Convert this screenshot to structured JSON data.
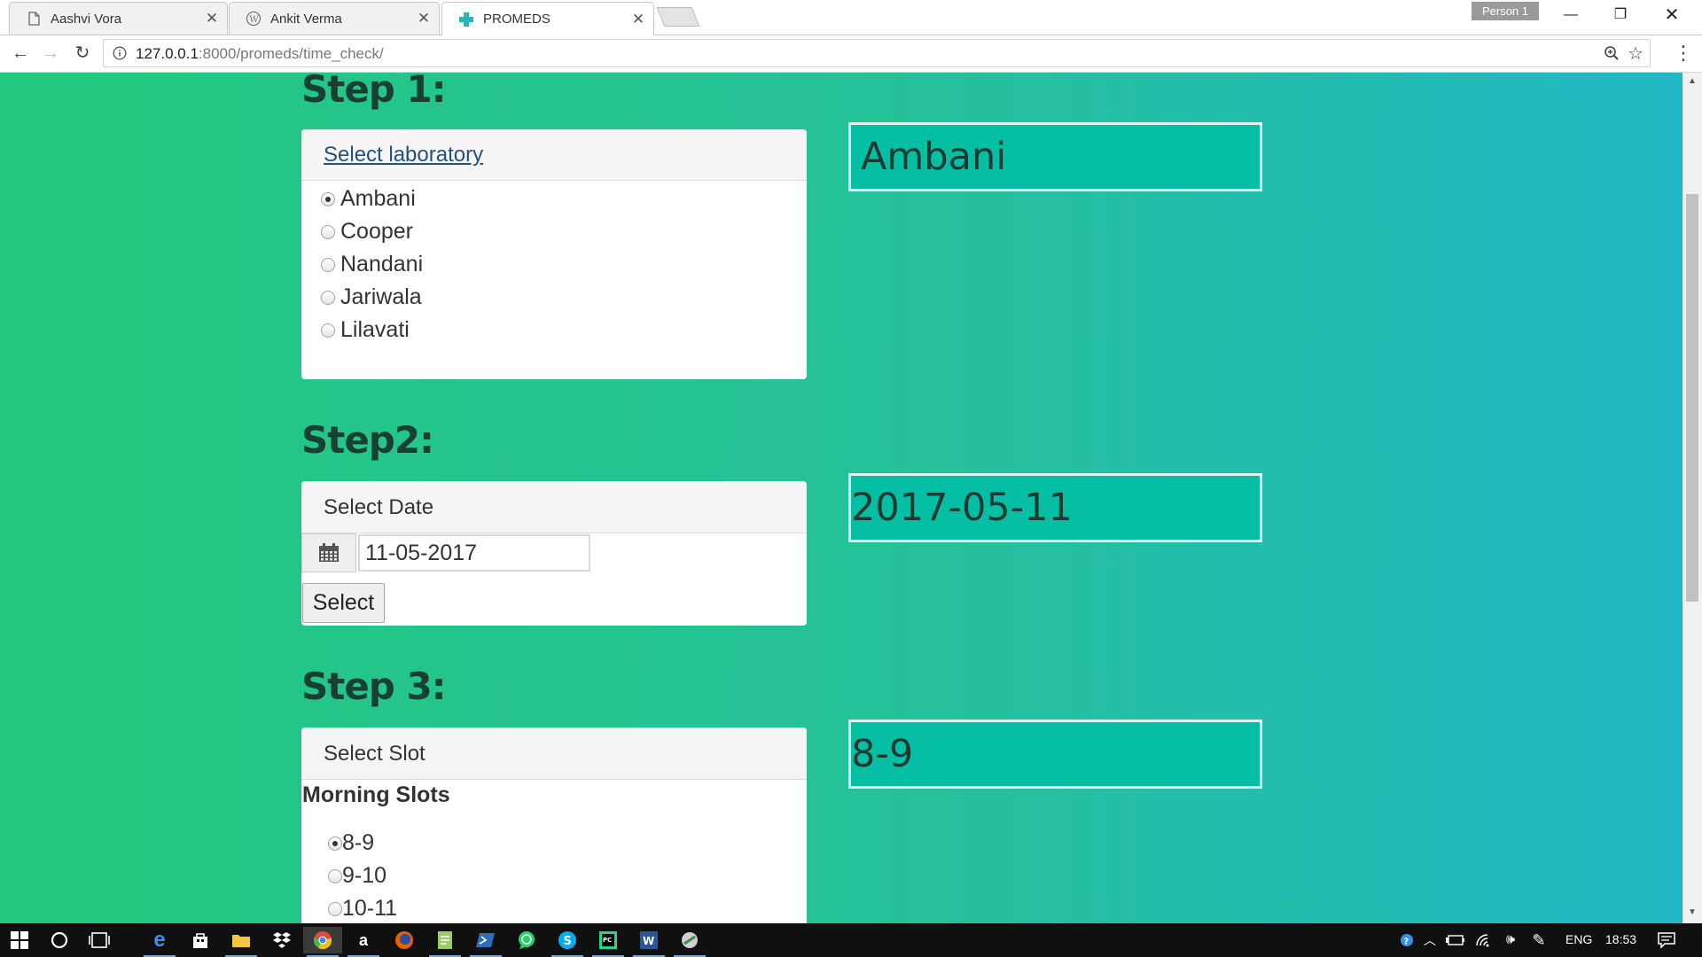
{
  "browser": {
    "tabs": [
      {
        "title": "Aashvi Vora",
        "icon": "page-icon",
        "active": false
      },
      {
        "title": "Ankit Verma",
        "icon": "wordpress-icon",
        "active": false
      },
      {
        "title": "PROMEDS",
        "icon": "medical-cross-icon",
        "active": true
      }
    ],
    "profile": "Person 1",
    "url_host": "127.0.0.1",
    "url_rest": ":8000/promeds/time_check/"
  },
  "step1": {
    "heading": "Step 1:",
    "panel_title": "Select laboratory",
    "options": [
      {
        "label": "Ambani",
        "checked": true
      },
      {
        "label": "Cooper",
        "checked": false
      },
      {
        "label": "Nandani",
        "checked": false
      },
      {
        "label": "Jariwala",
        "checked": false
      },
      {
        "label": "Lilavati",
        "checked": false
      }
    ],
    "result": "Ambani"
  },
  "step2": {
    "heading": "Step2:",
    "panel_title": "Select Date",
    "date_value": "11-05-2017",
    "button_label": "Select",
    "result": "2017-05-11"
  },
  "step3": {
    "heading": "Step 3:",
    "panel_title": "Select Slot",
    "group_title": "Morning Slots",
    "slots": [
      {
        "label": "8-9",
        "checked": true
      },
      {
        "label": "9-10",
        "checked": false
      },
      {
        "label": "10-11",
        "checked": false
      }
    ],
    "result": "8-9"
  },
  "taskbar": {
    "apps": [
      "start-icon",
      "cortana-icon",
      "task-view-icon",
      "edge-icon",
      "store-icon",
      "file-explorer-icon",
      "dropbox-icon",
      "chrome-icon",
      "amazon-icon",
      "firefox-icon",
      "notepad-icon",
      "powershell-icon",
      "whatsapp-icon",
      "skype-icon",
      "pycharm-icon",
      "word-icon",
      "app-icon"
    ],
    "language": "ENG",
    "time": "18:53"
  },
  "colors": {
    "gradient_start": "#23c97d",
    "gradient_end": "#21b8c4",
    "result_box": "#05bfa5",
    "heading_text": "#183f33"
  }
}
